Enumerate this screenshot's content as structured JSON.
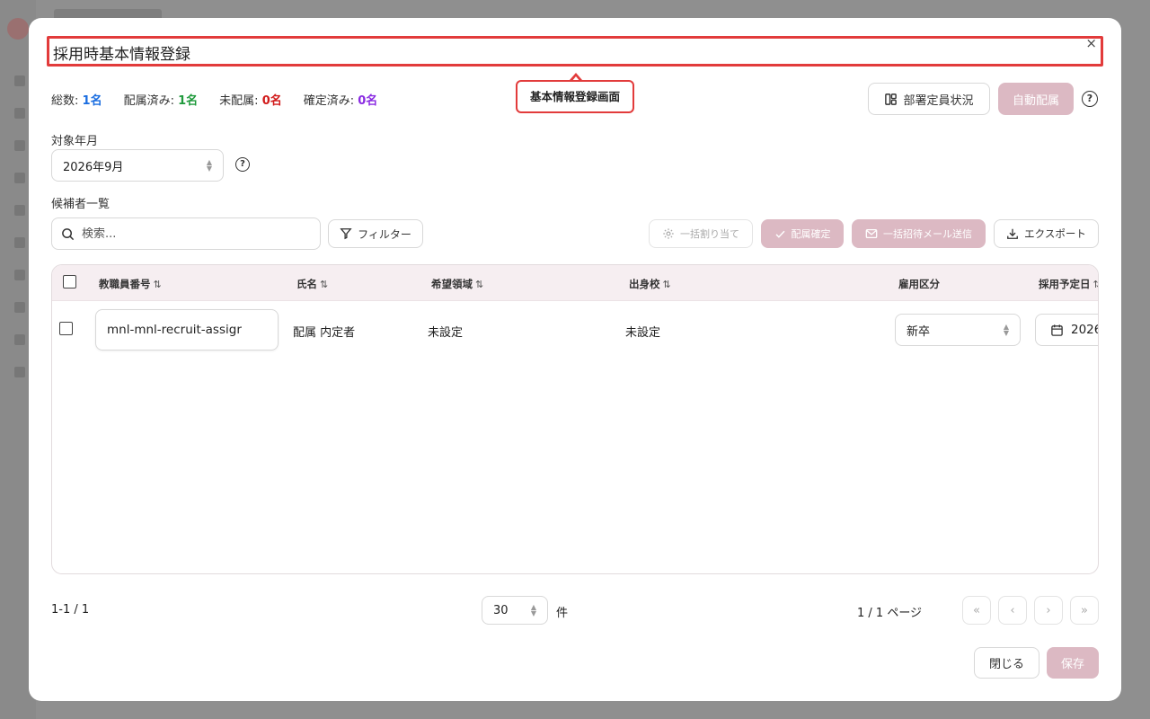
{
  "modal": {
    "title": "採用時基本情報登録",
    "close_glyph": "×",
    "tooltip": "基本情報登録画面"
  },
  "stats": [
    {
      "label": "総数:",
      "value": "1名",
      "color": "#1a6de0"
    },
    {
      "label": "配属済み:",
      "value": "1名",
      "color": "#1f9a3c"
    },
    {
      "label": "未配属:",
      "value": "0名",
      "color": "#d11a1a"
    },
    {
      "label": "確定済み:",
      "value": "0名",
      "color": "#8a2be2"
    }
  ],
  "header_actions": {
    "dept_status_label": "部署定員状況",
    "auto_assign_label": "自動配属",
    "help_glyph": "?"
  },
  "target": {
    "label": "対象年月",
    "value": "2026年9月",
    "help_glyph": "?"
  },
  "candidates": {
    "label": "候補者一覧",
    "search_placeholder": "検索...",
    "filter_label": "フィルター",
    "bulk_assign_label": "一括割り当て",
    "confirm_label": "配属確定",
    "bulk_invite_label": "一括招待メール送信",
    "export_label": "エクスポート"
  },
  "table": {
    "columns": [
      {
        "label": "教職員番号",
        "sortable": true
      },
      {
        "label": "氏名",
        "sortable": true
      },
      {
        "label": "希望領域",
        "sortable": true
      },
      {
        "label": "出身校",
        "sortable": true
      },
      {
        "label": "雇用区分",
        "sortable": false
      },
      {
        "label": "採用予定日",
        "sortable": true
      }
    ],
    "sort_glyph": "⇅",
    "rows": [
      {
        "staff_number": "mnl-mnl-recruit-assigr",
        "name": "配属 内定者",
        "desired_area": "未設定",
        "school": "未設定",
        "employment_type": "新卒",
        "hire_date": "2026"
      }
    ]
  },
  "pagination": {
    "range": "1-1 / 1",
    "page_size": "30",
    "page_size_unit": "件",
    "page_info": "1 / 1 ページ",
    "first_glyph": "«",
    "prev_glyph": "‹",
    "next_glyph": "›",
    "last_glyph": "»"
  },
  "footer": {
    "close_label": "閉じる",
    "save_label": "保存"
  }
}
